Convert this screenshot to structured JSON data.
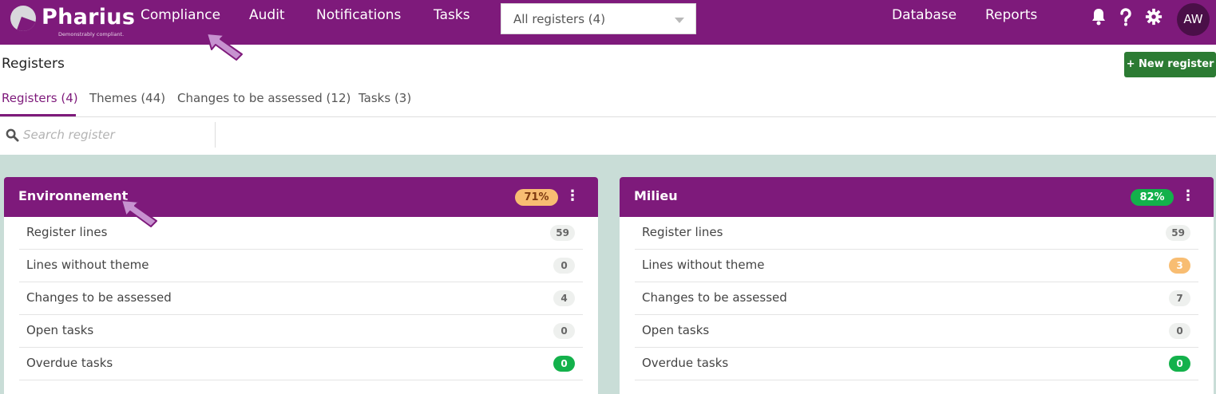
{
  "brand": {
    "name": "Pharius",
    "tagline": "Demonstrably compliant."
  },
  "nav": {
    "items": [
      "Compliance",
      "Audit",
      "Notifications",
      "Tasks"
    ],
    "right_items": [
      "Database",
      "Reports"
    ],
    "active": "Compliance"
  },
  "register_select": {
    "selected": "All registers (4)"
  },
  "user": {
    "initials": "AW"
  },
  "page": {
    "title": "Registers",
    "new_button": "New register"
  },
  "tabs": [
    "Registers (4)",
    "Themes (44)",
    "Changes to be assessed (12)",
    "Tasks (3)"
  ],
  "search": {
    "placeholder": "Search register"
  },
  "cards": [
    {
      "title": "Environnement",
      "percent": "71%",
      "rows": [
        {
          "label": "Register lines",
          "count": "59"
        },
        {
          "label": "Lines without theme",
          "count": "0"
        },
        {
          "label": "Changes to be assessed",
          "count": "4"
        },
        {
          "label": "Open tasks",
          "count": "0"
        },
        {
          "label": "Overdue tasks",
          "count": "0"
        }
      ]
    },
    {
      "title": "Milieu",
      "percent": "82%",
      "rows": [
        {
          "label": "Register lines",
          "count": "59"
        },
        {
          "label": "Lines without theme",
          "count": "3"
        },
        {
          "label": "Changes to be assessed",
          "count": "7"
        },
        {
          "label": "Open tasks",
          "count": "0"
        },
        {
          "label": "Overdue tasks",
          "count": "0"
        }
      ]
    }
  ],
  "colors": {
    "brand_purple": "#7e1a7b",
    "content_bg": "#c9ddd7",
    "success_green": "#13b14b",
    "warning_orange": "#f8bd72",
    "button_green": "#2c7b33",
    "annotation_arrow": "#c792d0"
  },
  "icons": [
    "bell-icon",
    "help-icon",
    "gear-icon",
    "search-icon",
    "kebab-menu-icon",
    "plus-icon",
    "chevron-down-icon"
  ]
}
